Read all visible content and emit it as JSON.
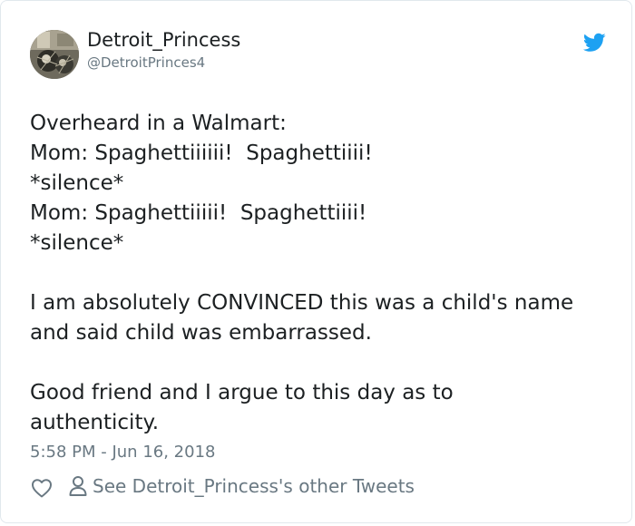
{
  "author": {
    "name": "Detroit_Princess",
    "handle": "@DetroitPrinces4"
  },
  "tweet": {
    "lines": [
      "Overheard in a Walmart:",
      "Mom: Spaghettiiiiii!  Spaghettiiii!",
      "*silence*",
      "Mom: Spaghettiiiii!  Spaghettiiii!",
      "*silence*",
      "",
      "I am absolutely CONVINCED this was a child's name",
      "and said child was embarrassed.",
      "",
      "Good friend and I argue to this day as to",
      "authenticity."
    ],
    "timestamp": "5:58 PM - Jun 16, 2018"
  },
  "actions": {
    "other_tweets_label": "See Detroit_Princess's other Tweets"
  },
  "icons": {
    "brand": "twitter-bird-icon",
    "like": "heart-icon",
    "profile": "person-icon"
  },
  "colors": {
    "twitter_blue": "#1da1f2",
    "text_primary": "#1c2022",
    "text_secondary": "#697882"
  }
}
